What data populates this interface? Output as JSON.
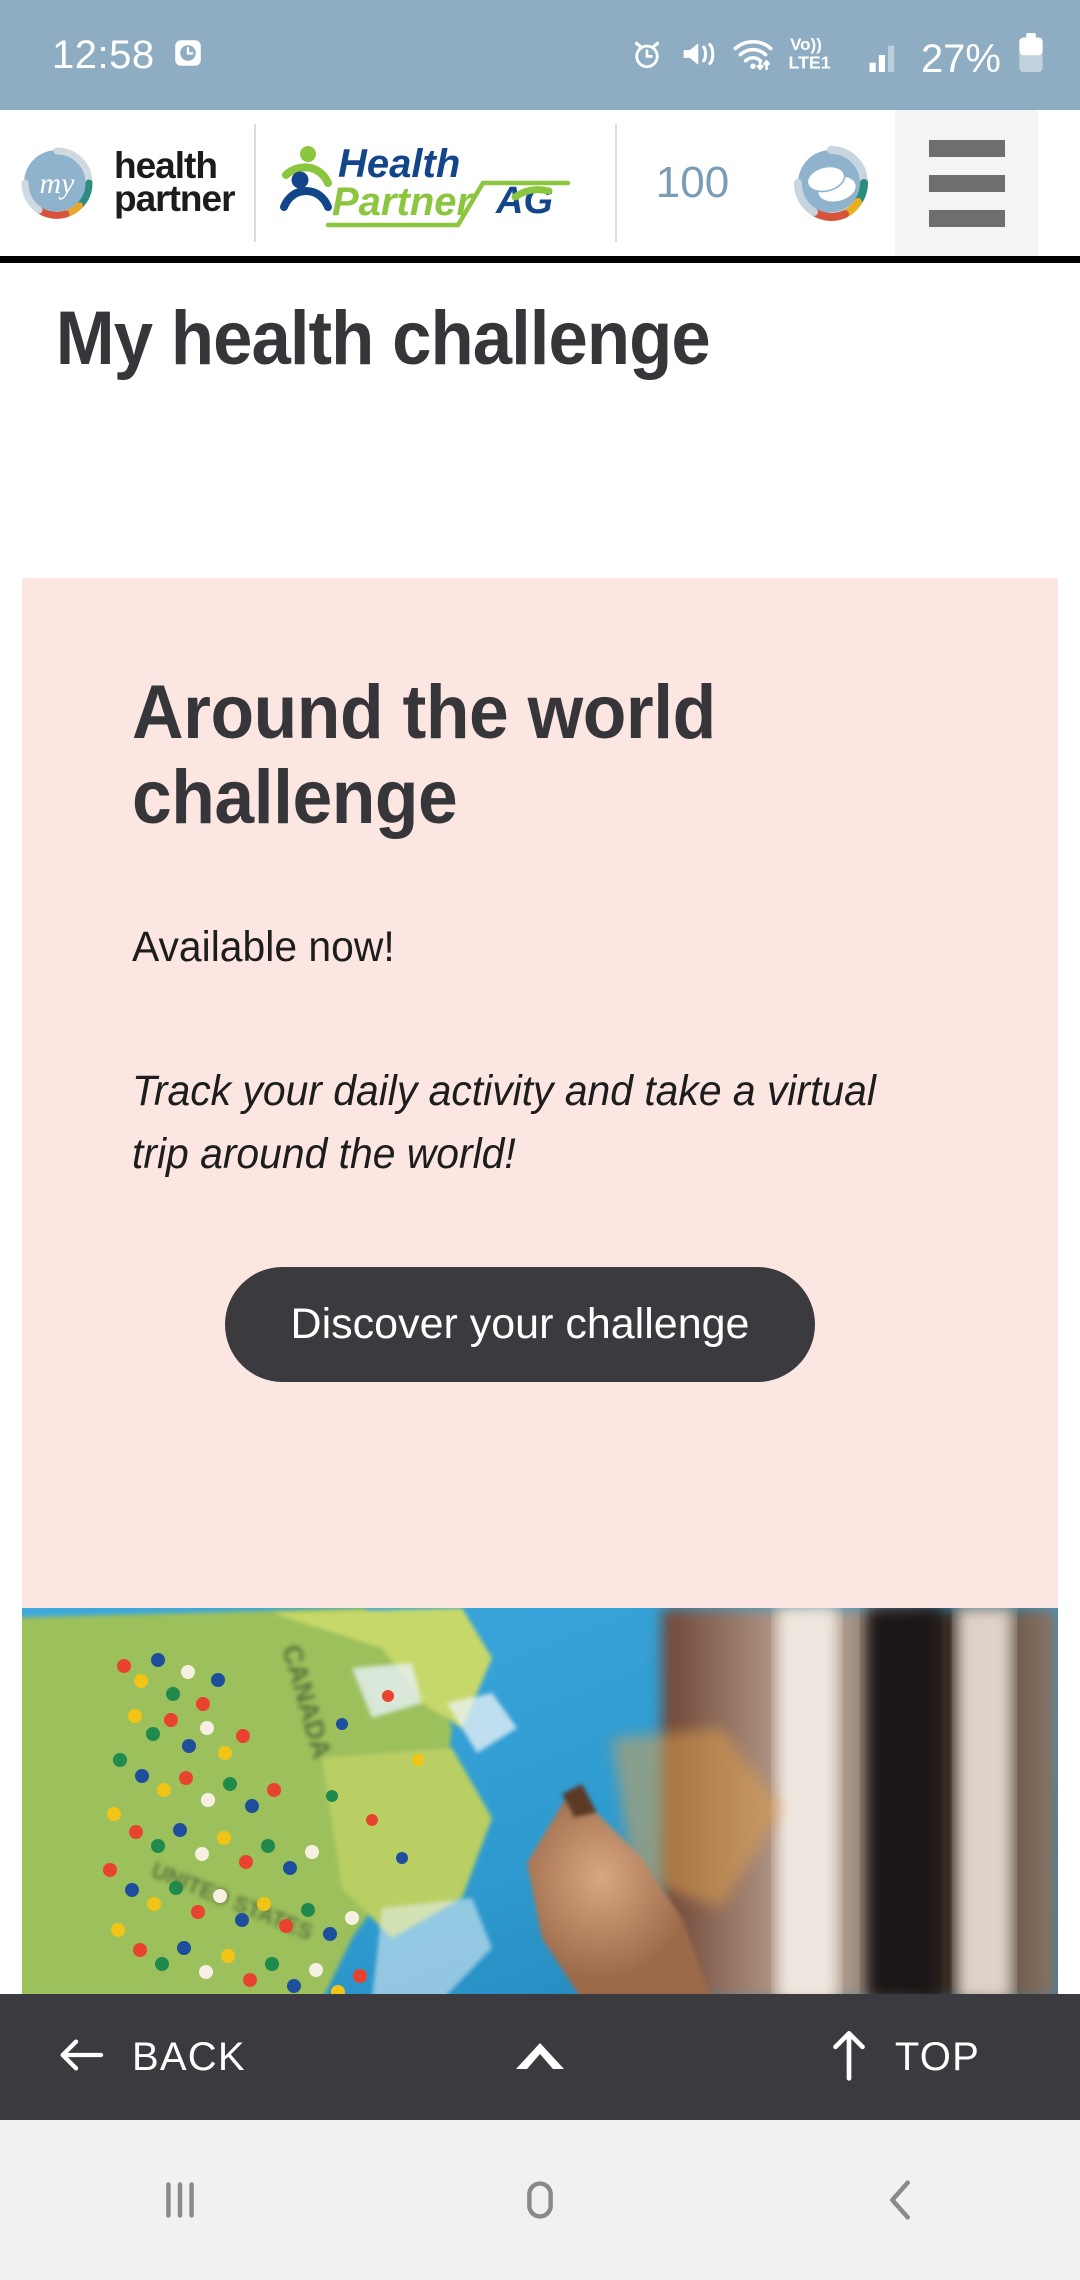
{
  "status_bar": {
    "time": "12:58",
    "battery_percent": "27%",
    "network_label": "Vo)) LTE1",
    "icons": [
      "alarm-clock-icon",
      "mute-vibrate-icon",
      "wifi-icon",
      "volte-icon",
      "signal-bars-icon",
      "battery-icon"
    ],
    "background": "#8fadc2"
  },
  "site_header": {
    "brand_primary": {
      "line1": "health",
      "line2": "partner",
      "mark_text": "my"
    },
    "brand_secondary": {
      "line1": "Health",
      "line2": "Partner",
      "partner_mark": "AG"
    },
    "points": "100",
    "points_badge_label": "coins-badge",
    "menu_label": "menu"
  },
  "page": {
    "title": "My health challenge"
  },
  "challenge_card": {
    "heading": "Around the world challenge",
    "availability": "Available now!",
    "description": "Track your daily activity and take a virtual trip around the world!",
    "cta_label": "Discover your challenge",
    "background": "#fce6e2",
    "cta_background": "#3b3b3f",
    "image_alt": "world map with colored pushpins and hand pointing"
  },
  "toolbar": {
    "back_label": "BACK",
    "top_label": "TOP",
    "scroll_up_label": "scroll-up",
    "background": "#3b3b3f"
  },
  "android_nav": {
    "recents_label": "recents",
    "home_label": "home",
    "back_label": "back"
  }
}
